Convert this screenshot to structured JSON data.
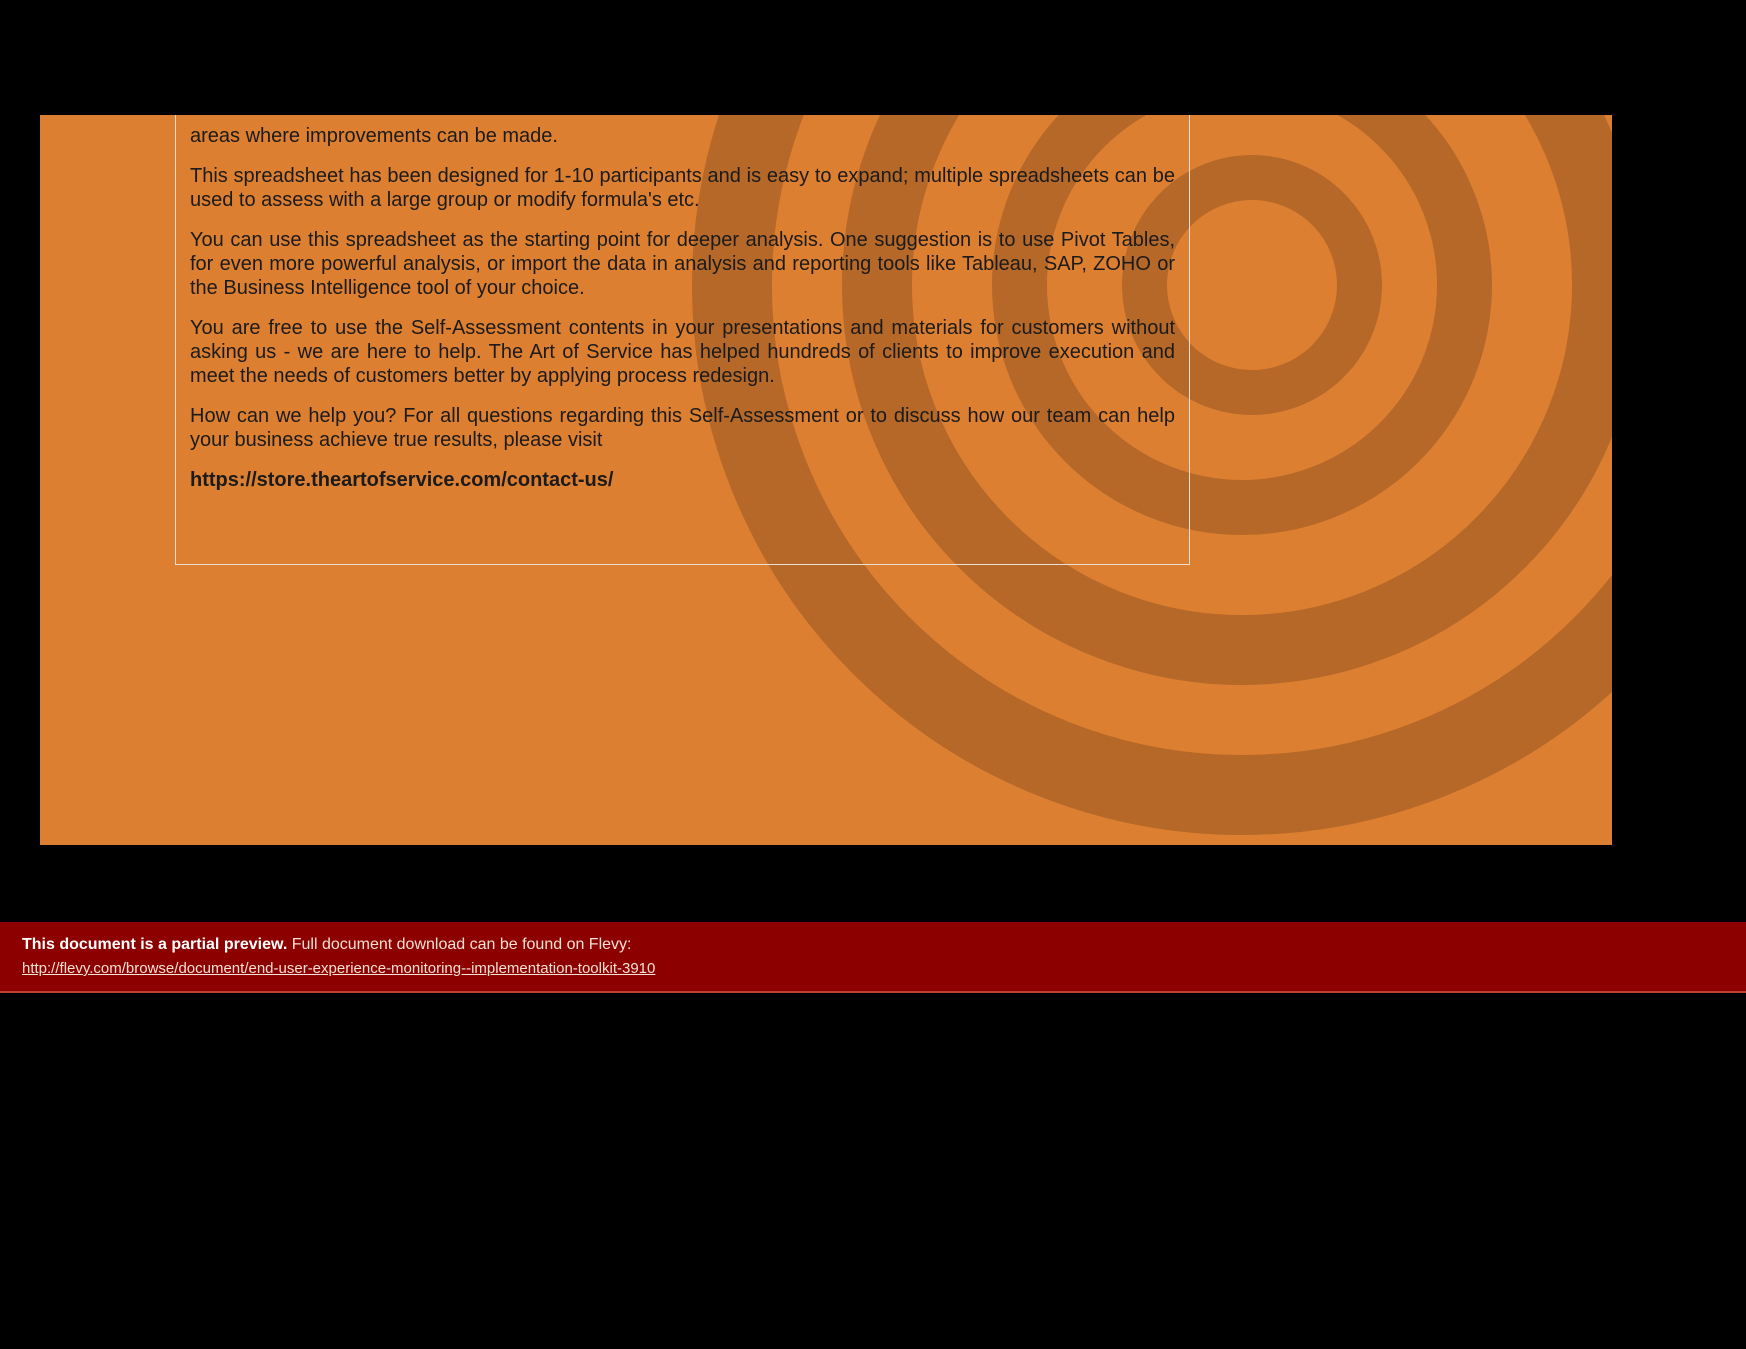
{
  "colors": {
    "page_bg": "#dd7f31",
    "banner_bg": "#8d0000",
    "text": "#1b1b1b",
    "light_text": "#f3e2d5"
  },
  "content": {
    "p1_tail": "areas where improvements can be made.",
    "p2": "This spreadsheet has been designed for 1-10 participants and is easy to expand; multiple spreadsheets can be used to assess with a large group or modify formula's etc.",
    "p3": "You can use this spreadsheet as the starting point for deeper analysis. One suggestion is to use Pivot Tables, for even more powerful analysis, or import the data in analysis and reporting tools like Tableau, SAP, ZOHO or the Business Intelligence tool of your choice.",
    "p4": "You are free to use the Self-Assessment contents in your presentations and materials for customers without asking us - we are here to help. The Art of Service has helped hundreds of clients to improve execution and meet the needs of customers better by applying process redesign.",
    "p5": "How can we help you? For all questions regarding this Self-Assessment or to discuss how our team can help your business achieve true results, please visit",
    "url": "https://store.theartofservice.com/contact-us/"
  },
  "banner": {
    "bold": "This document is a partial preview.",
    "rest": " Full document download can be found on Flevy:",
    "link": "http://flevy.com/browse/document/end-user-experience-monitoring--implementation-toolkit-3910"
  }
}
